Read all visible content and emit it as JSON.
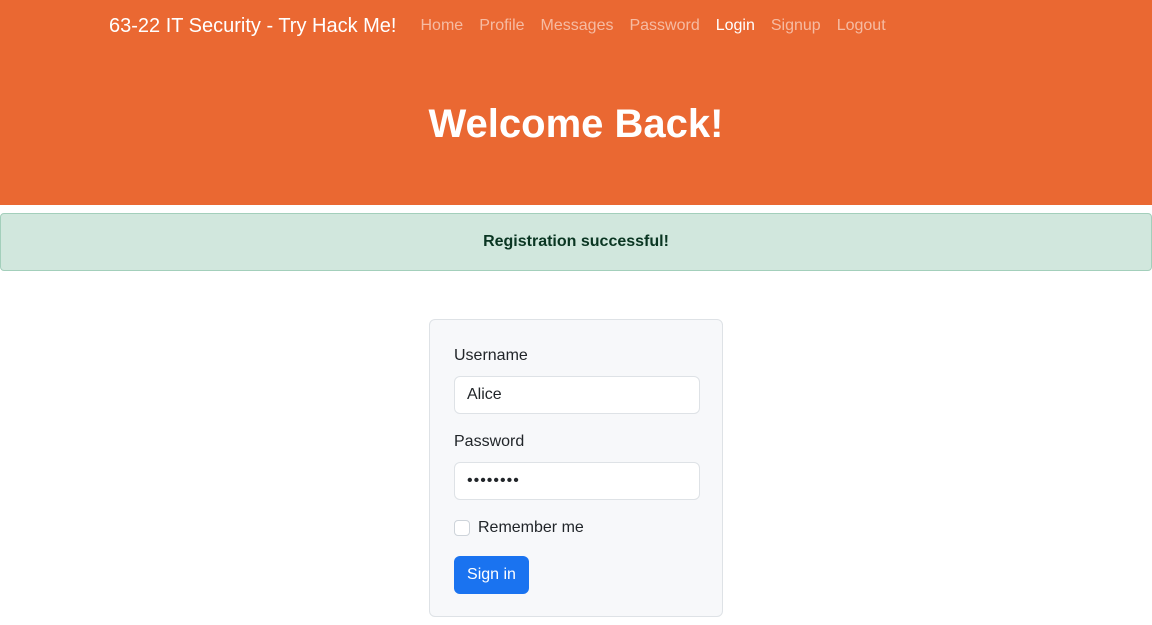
{
  "nav": {
    "brand": "63-22 IT Security - Try Hack Me!",
    "items": [
      {
        "label": "Home"
      },
      {
        "label": "Profile"
      },
      {
        "label": "Messages"
      },
      {
        "label": "Password"
      },
      {
        "label": "Login",
        "active": true
      },
      {
        "label": "Signup"
      },
      {
        "label": "Logout"
      }
    ]
  },
  "hero": {
    "title": "Welcome Back!"
  },
  "alert": {
    "message": "Registration successful!",
    "type": "success"
  },
  "form": {
    "username_label": "Username",
    "username_value": "Alice",
    "password_label": "Password",
    "password_value": "••••••••",
    "remember_label": "Remember me",
    "remember_checked": false,
    "submit_label": "Sign in"
  },
  "colors": {
    "brand": "#ea6832",
    "primary": "#1a73f0",
    "success_bg": "#d1e7dd"
  }
}
